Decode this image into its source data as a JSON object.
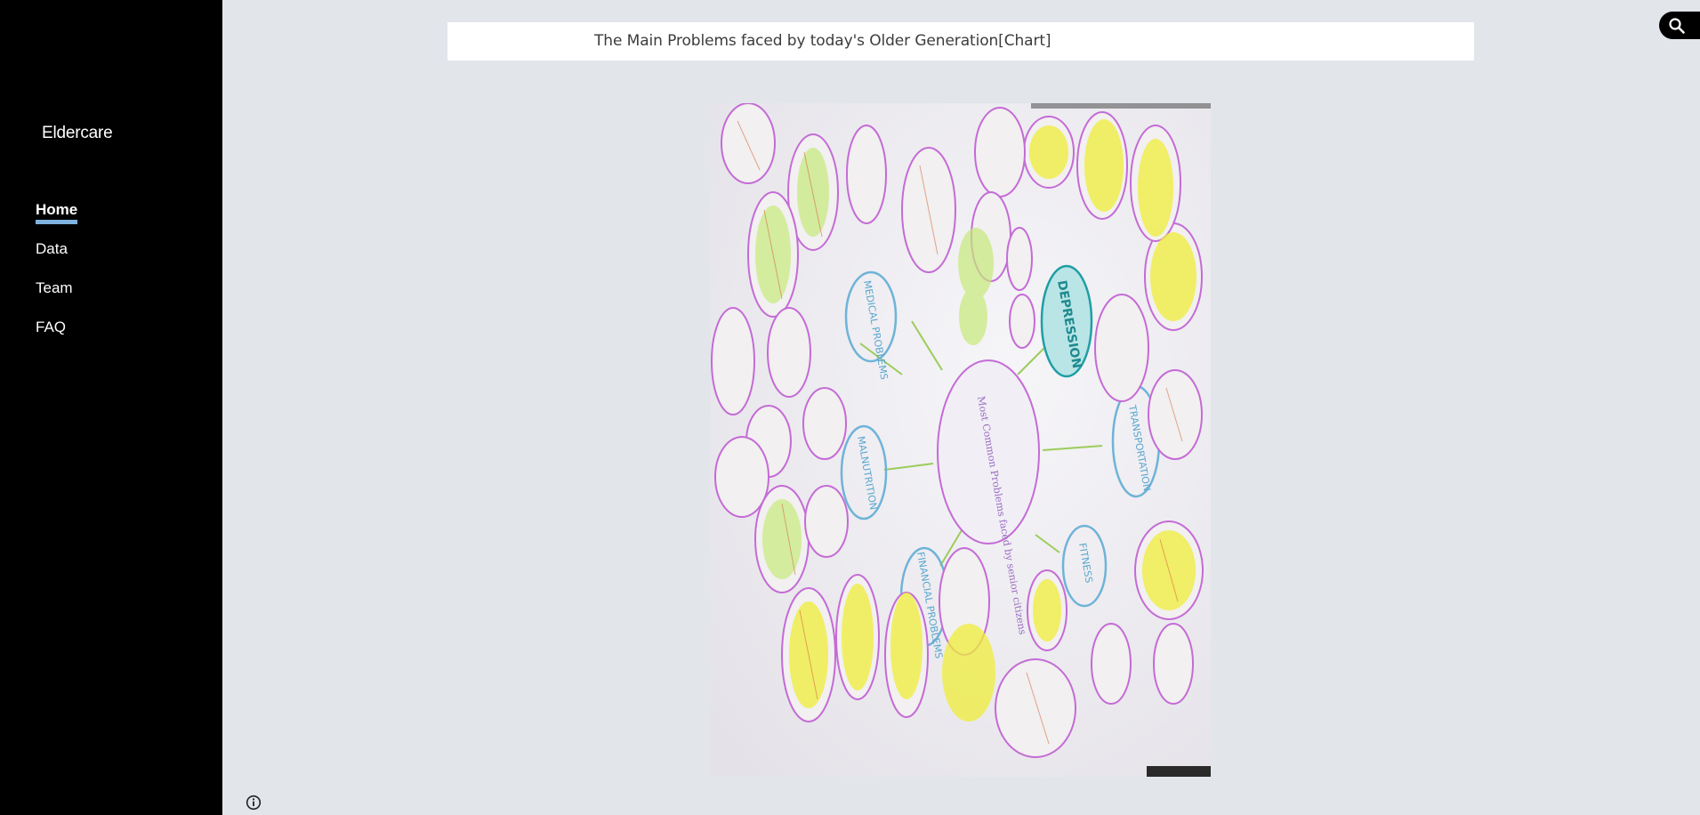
{
  "site": {
    "title": "Eldercare"
  },
  "nav": {
    "items": [
      {
        "label": "Home",
        "active": true
      },
      {
        "label": "Data",
        "active": false
      },
      {
        "label": "Team",
        "active": false
      },
      {
        "label": "FAQ",
        "active": false
      }
    ]
  },
  "main": {
    "caption": "The Main Problems faced by today's Older Generation[Chart]",
    "image": {
      "center_text": "Most Common Problems faced by senior citizens",
      "categories": [
        "MEDICAL PROBLEMS",
        "DEPRESSION",
        "TRANSPORTATION",
        "FITNESS",
        "FINANCIAL PROBLEMS",
        "MALNUTRITION"
      ]
    }
  },
  "icons": {
    "search": "search-icon",
    "info": "info-icon"
  },
  "colors": {
    "sidebar_bg": "#000000",
    "page_bg": "#e2e5ea",
    "nav_underline": "#7fb2de",
    "cloud_purple": "#c46bd6",
    "cloud_blue": "#6fb3d8",
    "highlight_yellow": "#f0ee3a",
    "depression_teal": "#1f9fa4"
  }
}
